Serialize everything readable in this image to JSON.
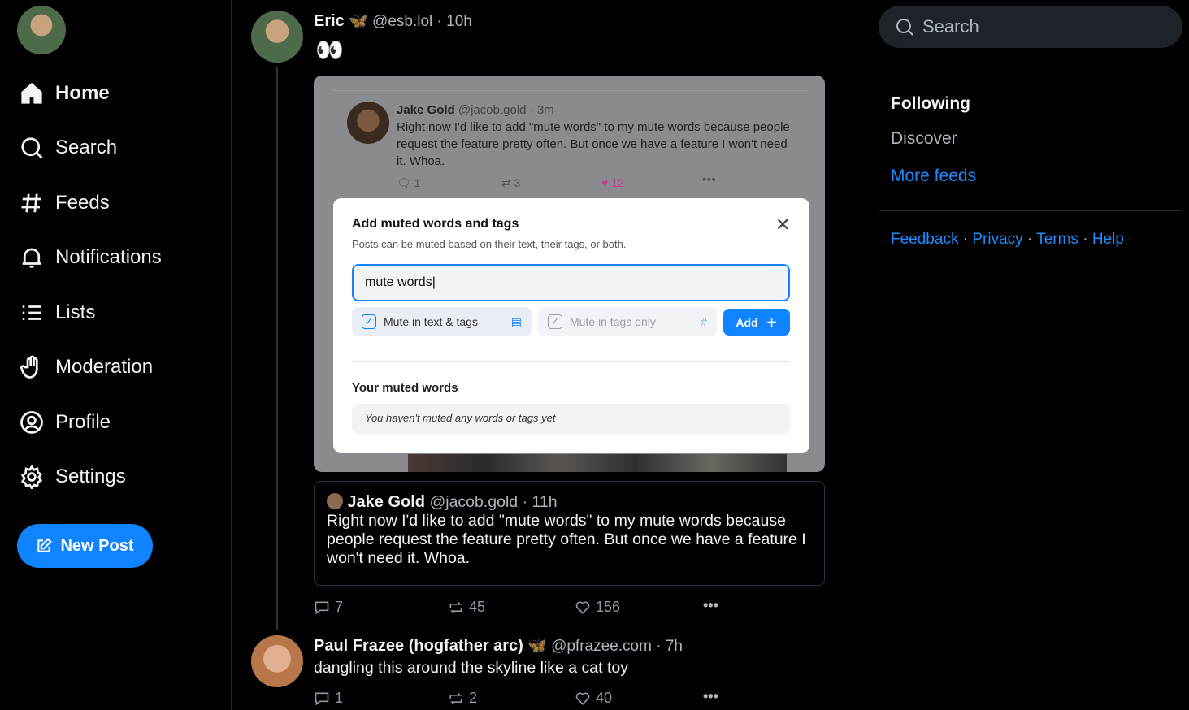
{
  "sidebar": {
    "items": [
      {
        "label": "Home",
        "icon": "home-icon"
      },
      {
        "label": "Search",
        "icon": "search-icon"
      },
      {
        "label": "Feeds",
        "icon": "hash-icon"
      },
      {
        "label": "Notifications",
        "icon": "bell-icon"
      },
      {
        "label": "Lists",
        "icon": "list-icon"
      },
      {
        "label": "Moderation",
        "icon": "hand-icon"
      },
      {
        "label": "Profile",
        "icon": "user-circle-icon"
      },
      {
        "label": "Settings",
        "icon": "gear-icon"
      }
    ],
    "new_post": "New Post"
  },
  "post1": {
    "name": "Eric",
    "emoji": "🦋",
    "handle": "@esb.lol",
    "time": "10h",
    "text": "👀",
    "image": {
      "inner_post": {
        "name": "Jake Gold",
        "handle": "@jacob.gold",
        "time": "3m",
        "text": "Right now I'd like to add \"mute words\" to my mute words because people request the feature pretty often. But once we have a feature I won't need it. Whoa.",
        "replies": "1",
        "reposts": "3",
        "likes": "12"
      },
      "dialog": {
        "title": "Add muted words and tags",
        "subtitle": "Posts can be muted based on their text, their tags, or both.",
        "input_value": "mute words",
        "opt1": "Mute in text & tags",
        "opt2": "Mute in tags only",
        "add": "Add",
        "section": "Your muted words",
        "empty": "You haven't muted any words or tags yet"
      }
    },
    "quote": {
      "name": "Jake Gold",
      "handle": "@jacob.gold",
      "time": "11h",
      "text": "Right now I'd like to add \"mute words\" to my mute words because people request the feature pretty often. But once we have a feature I won't need it. Whoa."
    },
    "replies": "7",
    "reposts": "45",
    "likes": "156"
  },
  "post2": {
    "name": "Paul Frazee (hogfather arc)",
    "emoji": "🦋",
    "handle": "@pfrazee.com",
    "time": "7h",
    "text": "dangling this around the skyline like a cat toy",
    "replies": "1",
    "reposts": "2",
    "likes": "40"
  },
  "right": {
    "search_placeholder": "Search",
    "feeds": [
      "Following",
      "Discover"
    ],
    "more_feeds": "More feeds",
    "footer": [
      "Feedback",
      "Privacy",
      "Terms",
      "Help"
    ]
  },
  "colors": {
    "accent": "#1083fe",
    "link": "#208bfe",
    "like": "#c2408a"
  }
}
